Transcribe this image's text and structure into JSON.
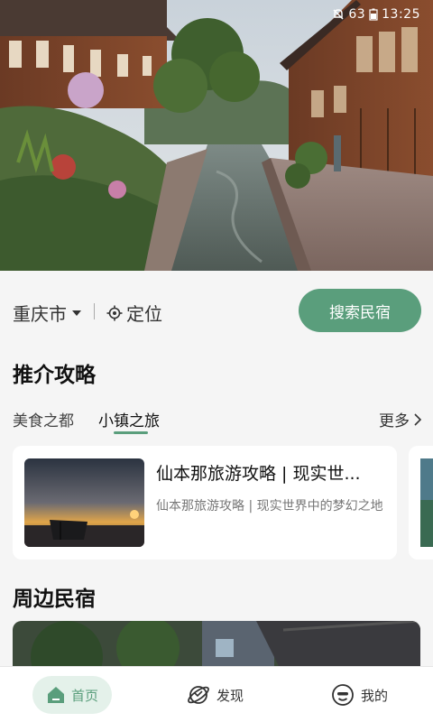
{
  "status": {
    "battery": "63",
    "time": "13:25"
  },
  "location": {
    "city": "重庆市",
    "locate_label": "定位",
    "search_button": "搜索民宿"
  },
  "guides": {
    "title": "推介攻略",
    "tabs": [
      "美食之都",
      "小镇之旅"
    ],
    "active_tab": 1,
    "more_label": "更多",
    "cards": [
      {
        "title": "仙本那旅游攻略 | 现实世...",
        "desc": "仙本那旅游攻略 | 现实世界中的梦幻之地"
      }
    ]
  },
  "nearby": {
    "title": "周边民宿"
  },
  "bottom_nav": [
    {
      "label": "首页",
      "icon": "home-icon",
      "active": true
    },
    {
      "label": "发现",
      "icon": "planet-icon",
      "active": false
    },
    {
      "label": "我的",
      "icon": "smile-face-icon",
      "active": false
    }
  ],
  "colors": {
    "accent": "#5a9e7c",
    "accent_light": "#e4f1ea"
  }
}
